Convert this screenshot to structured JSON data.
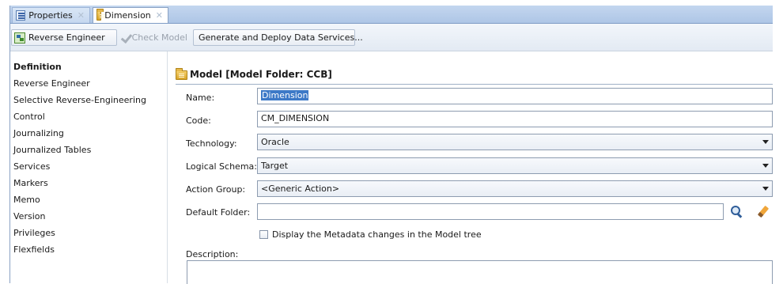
{
  "tabs": [
    {
      "label": "Properties",
      "icon": "properties-icon",
      "active": false
    },
    {
      "label": "Dimension",
      "icon": "model-folder-icon",
      "active": true
    }
  ],
  "toolbar": {
    "reverse_engineer_label": "Reverse Engineer",
    "check_model_label": "Check Model",
    "generate_label": "Generate and Deploy Data Services..."
  },
  "nav": {
    "items": [
      "Definition",
      "Reverse Engineer",
      "Selective Reverse-Engineering",
      "Control",
      "Journalizing",
      "Journalized Tables",
      "Services",
      "Markers",
      "Memo",
      "Version",
      "Privileges",
      "Flexfields"
    ],
    "selected": "Definition"
  },
  "main": {
    "title": "Model [Model Folder: CCB]",
    "fields": {
      "name_label": "Name:",
      "name_value": "Dimension",
      "code_label": "Code:",
      "code_value": "CM_DIMENSION",
      "technology_label": "Technology:",
      "technology_value": "Oracle",
      "logical_schema_label": "Logical Schema:",
      "logical_schema_value": "Target",
      "action_group_label": "Action Group:",
      "action_group_value": "<Generic Action>",
      "default_folder_label": "Default Folder:",
      "default_folder_value": ""
    },
    "checkbox_label": "Display the Metadata changes in the Model tree",
    "checkbox_checked": false,
    "description_label": "Description:",
    "description_value": ""
  },
  "colors": {
    "tabstrip": "#b7cdea",
    "selection": "#3d79c7"
  }
}
